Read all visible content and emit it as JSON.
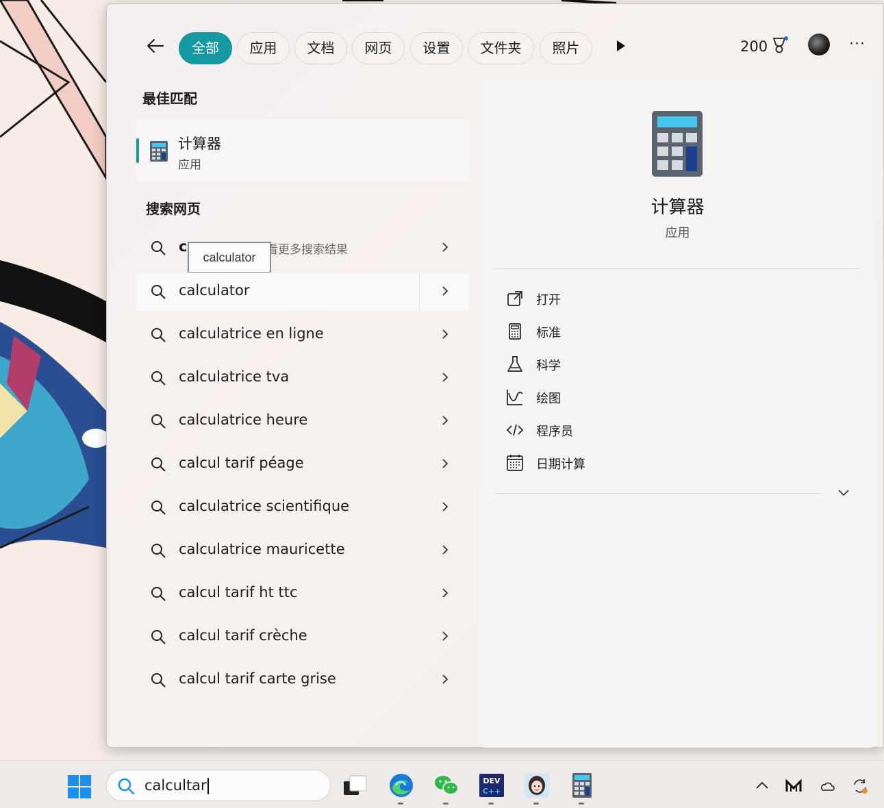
{
  "filter_bar": {
    "back_icon": "arrow-left-icon",
    "tabs": [
      {
        "label": "全部",
        "active": true
      },
      {
        "label": "应用",
        "active": false
      },
      {
        "label": "文档",
        "active": false
      },
      {
        "label": "网页",
        "active": false
      },
      {
        "label": "设置",
        "active": false
      },
      {
        "label": "文件夹",
        "active": false
      },
      {
        "label": "照片",
        "active": false
      }
    ],
    "more_tabs_icon": "play-icon",
    "rewards_points": "200",
    "rewards_icon": "trophy-icon",
    "overflow_label": "···",
    "accent_color": "#159aa4"
  },
  "best_match": {
    "heading": "最佳匹配",
    "app_name": "计算器",
    "app_type": "应用"
  },
  "web_search": {
    "heading": "搜索网页",
    "first_row_prefix": "ca",
    "first_row_hint": "看更多搜索结果",
    "tooltip": "calculator",
    "suggestions": [
      "calculator",
      "calculatrice en ligne",
      "calculatrice tva",
      "calculatrice heure",
      "calcul tarif péage",
      "calculatrice scientifique",
      "calculatrice mauricette",
      "calcul tarif ht ttc",
      "calcul tarif crèche",
      "calcul tarif carte grise"
    ]
  },
  "preview": {
    "app_name": "计算器",
    "app_type": "应用",
    "actions": [
      {
        "label": "打开",
        "icon": "open-external-icon"
      },
      {
        "label": "标准",
        "icon": "calculator-icon"
      },
      {
        "label": "科学",
        "icon": "flask-icon"
      },
      {
        "label": "绘图",
        "icon": "graph-icon"
      },
      {
        "label": "程序员",
        "icon": "code-icon"
      },
      {
        "label": "日期计算",
        "icon": "calendar-icon"
      }
    ]
  },
  "taskbar": {
    "search_value": "calcultar",
    "apps": [
      "task-view",
      "edge",
      "wechat",
      "dev-cpp",
      "avatar-app",
      "calculator"
    ]
  }
}
